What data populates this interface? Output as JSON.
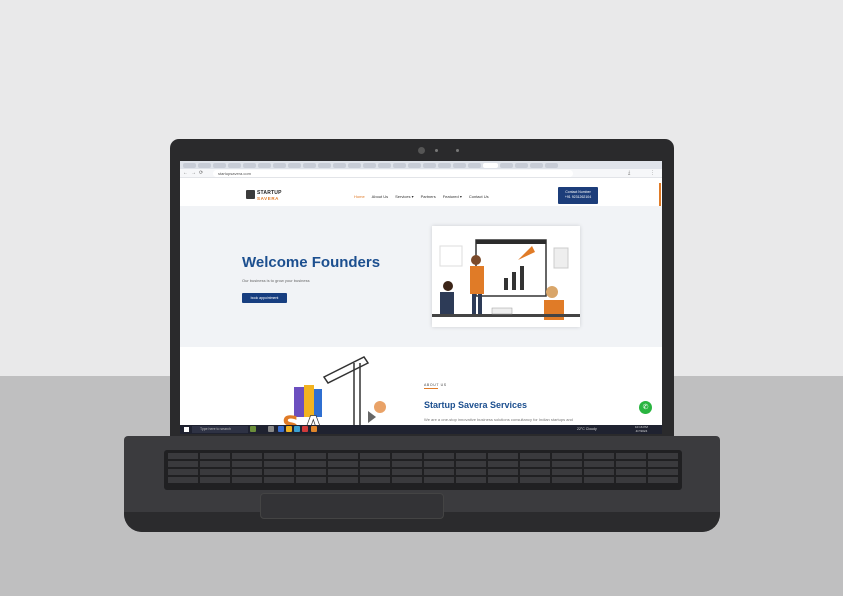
{
  "browser": {
    "url": "startupsavera.com"
  },
  "site": {
    "logo": {
      "line1": "STARTUP",
      "line2": "SAVERA"
    },
    "menu": [
      "Home",
      "About Us",
      "Services ▾",
      "Partners",
      "Featured ▾",
      "Contact Us"
    ],
    "contact": {
      "label": "Contact Number",
      "number": "+91 9231262104"
    }
  },
  "hero": {
    "title": "Welcome Founders",
    "subtitle": "Our business is to grow your business",
    "button": "book appointment"
  },
  "about": {
    "tag": "ABOUT US",
    "title": "Startup Savera Services",
    "text": "We are a one-stop innovative business solutions consultancy for Indian startups and"
  },
  "taskbar": {
    "search_placeholder": "Type here to search",
    "weather": "22°C Cloudy",
    "time": "10:16 PM",
    "date": "4/7/2024"
  },
  "colors": {
    "brand_blue": "#1c4f8f",
    "brand_orange": "#e07b27",
    "whatsapp_green": "#2ab540"
  }
}
